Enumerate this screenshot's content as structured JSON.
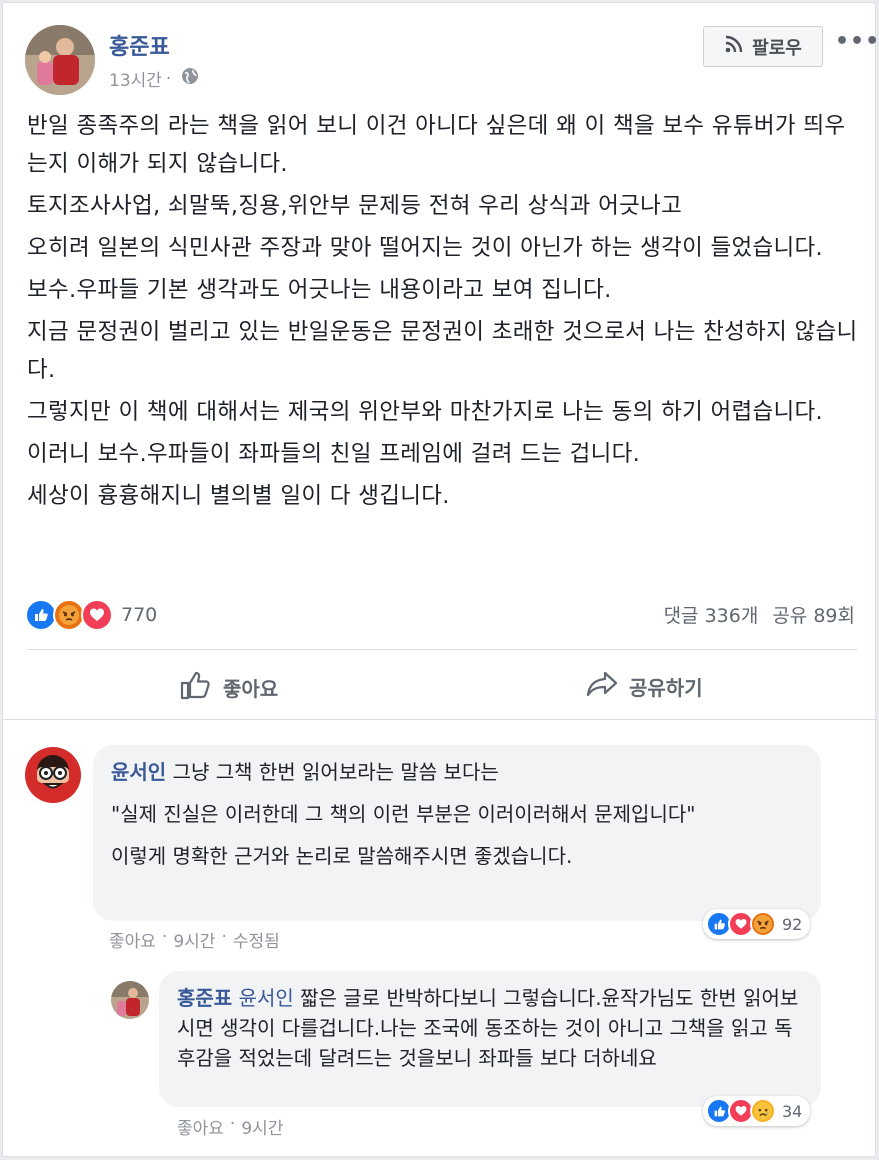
{
  "post": {
    "author": "홍준표",
    "time": "13시간",
    "dot": "·",
    "follow_label": "팔로우",
    "more_label": "•••",
    "paragraphs": [
      "반일 종족주의 라는 책을 읽어 보니 이건 아니다 싶은데 왜 이 책을 보수 유튜버가 띄우는지 이해가 되지 않습니다.",
      "토지조사사업, 쇠말뚝,징용,위안부 문제등 전혀 우리 상식과 어긋나고",
      "오히려 일본의 식민사관 주장과 맞아 떨어지는 것이 아닌가 하는 생각이 들었습니다.",
      "보수.우파들 기본 생각과도 어긋나는 내용이라고 보여 집니다.",
      "지금 문정권이 벌리고 있는 반일운동은 문정권이 초래한 것으로서 나는 찬성하지 않습니다.",
      "그렇지만 이 책에 대해서는 제국의 위안부와 마찬가지로 나는 동의 하기 어렵습니다.",
      "이러니 보수.우파들이 좌파들의 친일 프레임에 걸려 드는 겁니다.",
      "세상이 흉흉해지니 별의별 일이 다 생깁니다."
    ],
    "reaction_count": "770",
    "comments_count": "댓글 336개",
    "shares_count": "공유 89회",
    "like_action": "좋아요",
    "share_action": "공유하기"
  },
  "comments": [
    {
      "name": "윤서인",
      "lines": [
        "그냥 그책 한번 읽어보라는 말씀 보다는",
        "\"실제 진실은 이러한데 그 책의 이런 부분은 이러이러해서 문제입니다\"",
        "이렇게 명확한 근거와 논리로 말씀해주시면 좋겠습니다."
      ],
      "like": "좋아요",
      "dot": "·",
      "time": "9시간",
      "edited": "수정됨",
      "reaction_count": "92"
    },
    {
      "name": "홍준표",
      "mention": "윤서인",
      "text": "짧은 글로 반박하다보니 그렇습니다.윤작가님도 한번 읽어보시면 생각이 다를겁니다.나는 조국에 동조하는 것이 아니고 그책을 읽고 독후감을 적었는데 달려드는 것을보니 좌파들 보다 더하네요",
      "like": "좋아요",
      "dot": "·",
      "time": "9시간",
      "reaction_count": "34"
    }
  ],
  "colors": {
    "link": "#385898",
    "muted": "#90949c",
    "like_blue": "#1877f2",
    "love_red": "#f33e58",
    "angry_orange": "#e9710f"
  }
}
